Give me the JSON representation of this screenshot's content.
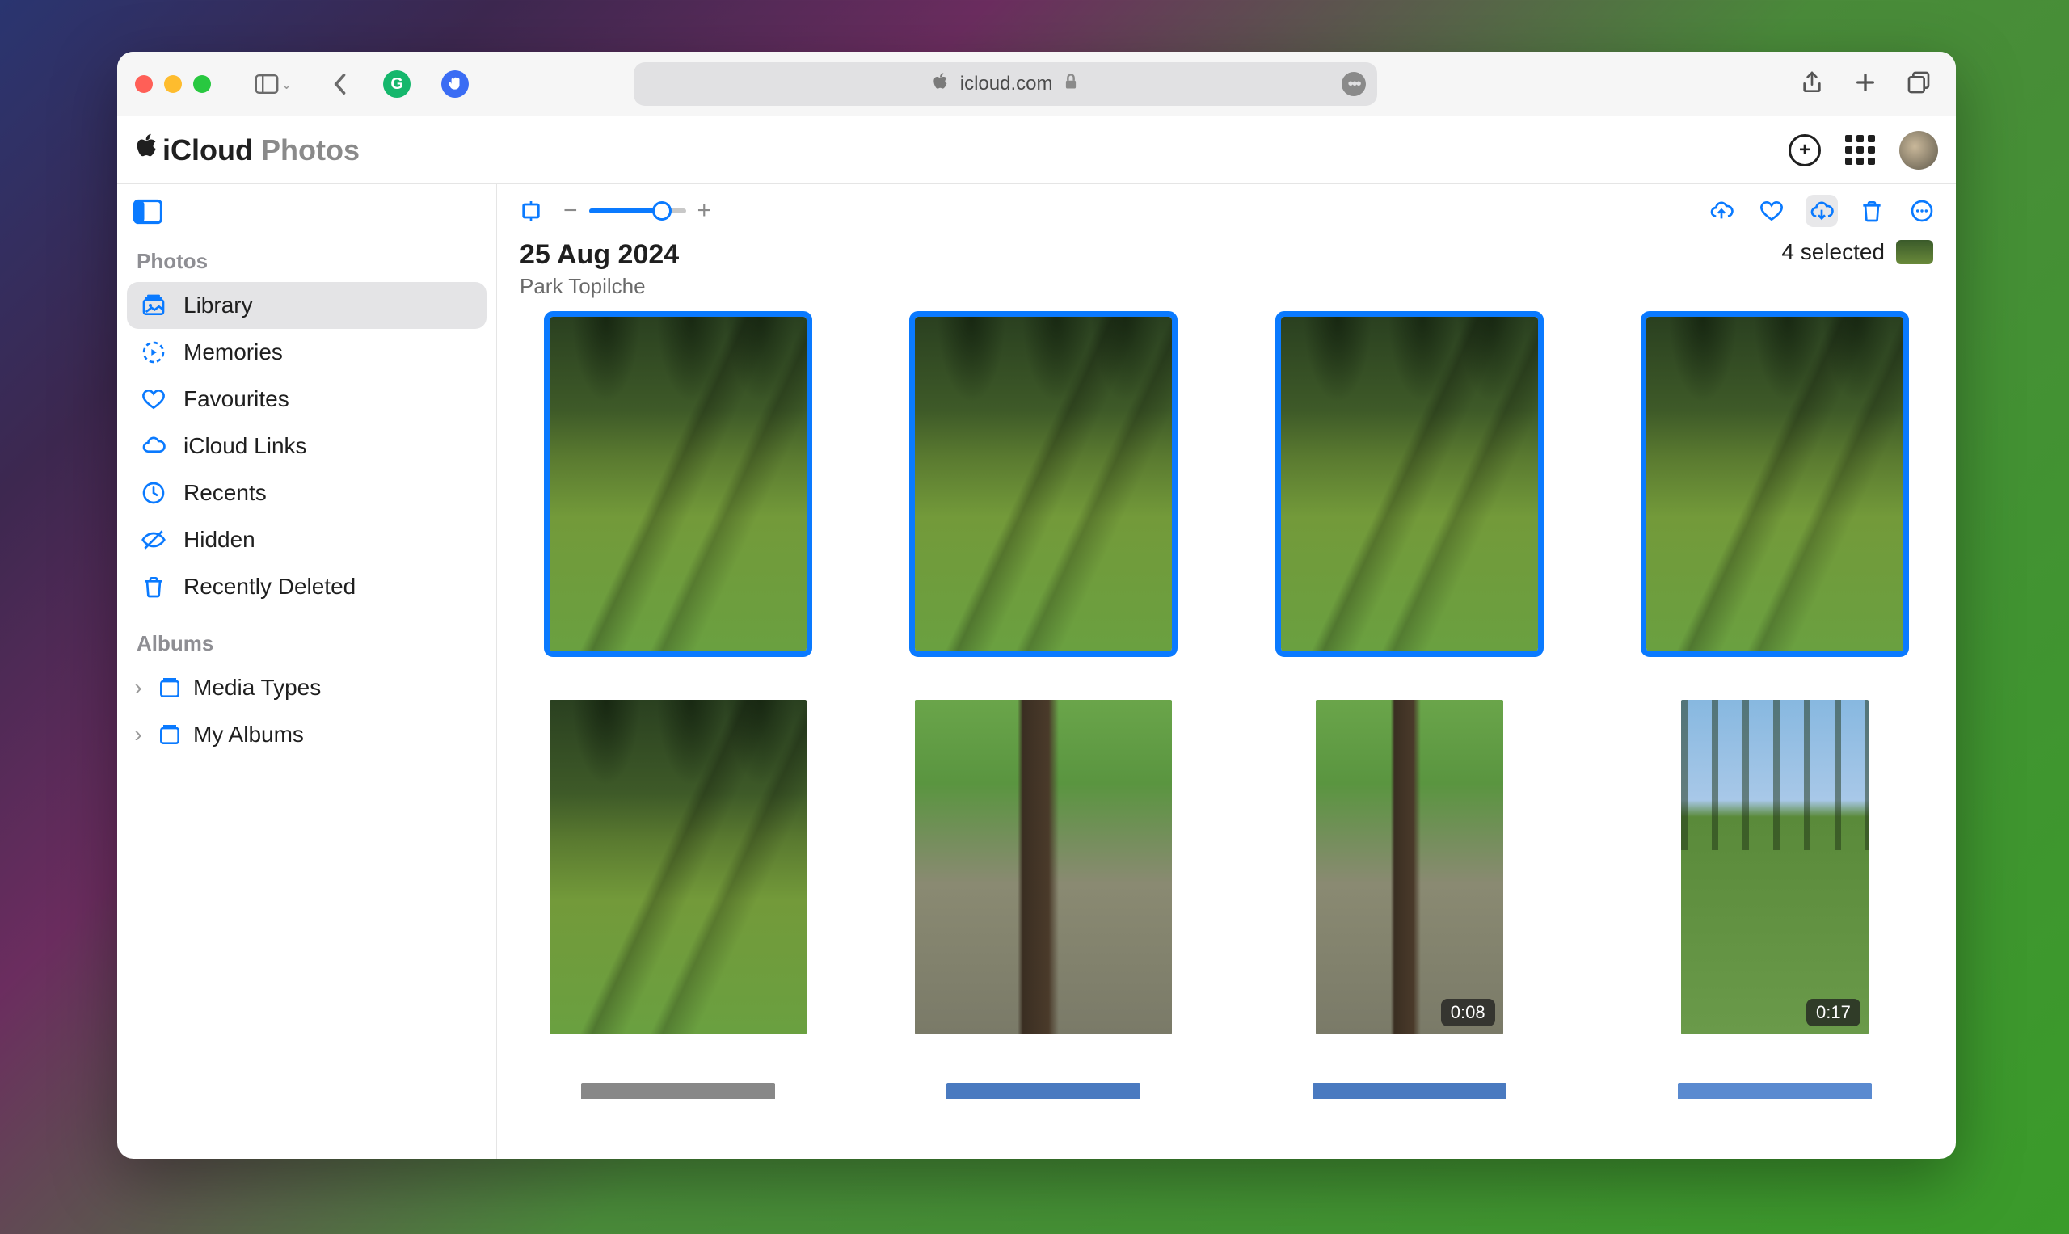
{
  "browser": {
    "url": "icloud.com"
  },
  "app": {
    "brand": "iCloud",
    "section": "Photos"
  },
  "sidebar": {
    "sections": {
      "photos_label": "Photos",
      "albums_label": "Albums"
    },
    "items": {
      "library": "Library",
      "memories": "Memories",
      "favourites": "Favourites",
      "icloud_links": "iCloud Links",
      "recents": "Recents",
      "hidden": "Hidden",
      "recently_deleted": "Recently Deleted",
      "media_types": "Media Types",
      "my_albums": "My Albums"
    }
  },
  "content": {
    "date_title": "25 Aug 2024",
    "location": "Park Topilche",
    "selected_text": "4 selected",
    "zoom": {
      "minus": "−",
      "plus": "+"
    },
    "thumbs": [
      {
        "selected": true
      },
      {
        "selected": true
      },
      {
        "selected": true
      },
      {
        "selected": true
      },
      {
        "selected": false
      },
      {
        "selected": false
      },
      {
        "selected": false,
        "duration": "0:08"
      },
      {
        "selected": false,
        "duration": "0:17"
      }
    ]
  }
}
